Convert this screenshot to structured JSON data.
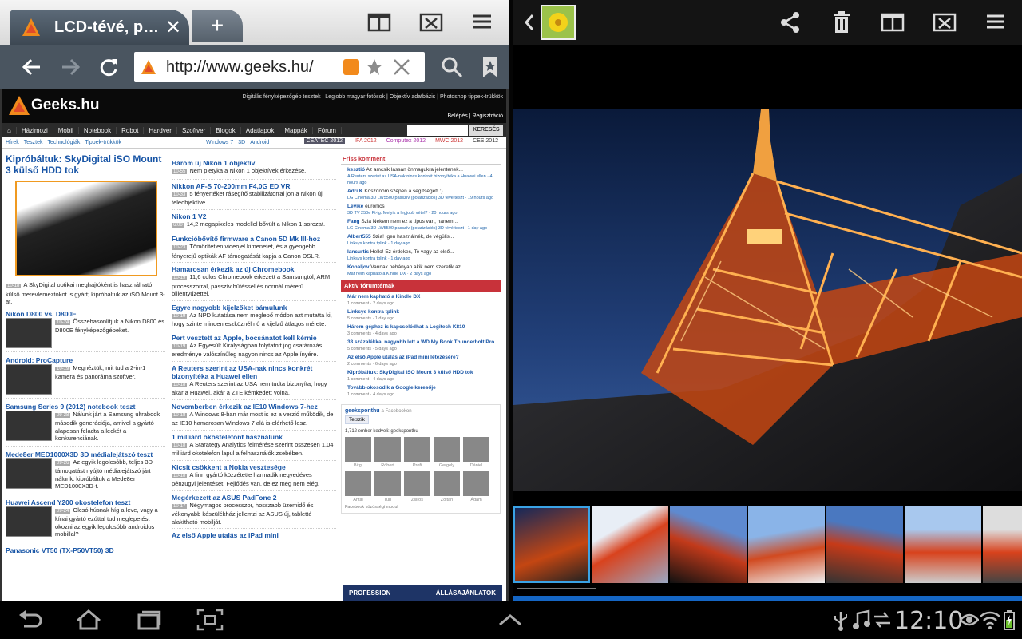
{
  "browser": {
    "tab_title": "LCD-tévé, p…",
    "url": "http://www.geeks.hu/"
  },
  "site": {
    "logo_text": "Geeks.hu",
    "top_links": "Digitális fényképezőgép tesztek | Legjobb magyar fotósok | Objektív adatbázis | Photoshop tippek-trükkök",
    "login": "Belépés | Regisztráció",
    "nav": [
      "Házimozi",
      "Mobil",
      "Notebook",
      "Robot",
      "Hardver",
      "Szoftver",
      "Blogok",
      "Adatlapok",
      "Mappák",
      "Fórum"
    ],
    "search_button": "KERESÉS",
    "sub_nav": [
      "Hírek",
      "Tesztek",
      "Technológiák",
      "Tippek-trükkök"
    ],
    "sub_nav2": [
      "Windows 7",
      "3D",
      "Android"
    ],
    "events": [
      "CEATEC 2012",
      "IFA 2012",
      "Computex 2012",
      "MWC 2012",
      "CES 2012"
    ],
    "main_title": "Kipróbáltuk: SkyDigital iSO Mount 3 külső HDD tok",
    "main_date": "10-18",
    "main_text": "A SkyDigital optikai meghajtóként is használható külső merevlemeztokot is gyárt; kipróbáltuk az iSO Mount 3-at.",
    "left_articles": [
      {
        "title": "Nikon D800 vs. D800E",
        "date": "10-24",
        "text": "Összehasonlítjuk a Nikon D800 és D800E fényképezőgépeket."
      },
      {
        "title": "Android: ProCapture",
        "date": "10-19",
        "text": "Megnéztük, mit tud a 2-in-1 kamera és panoráma szoftver."
      },
      {
        "title": "Samsung Series 9 (2012) notebook teszt",
        "date": "09-28",
        "text": "Nálunk járt a Samsung ultrabook második generációja, amivel a gyártó alaposan feladta a leckét a konkurenciának."
      },
      {
        "title": "Mede8er MED1000X3D 3D médialejátszó teszt",
        "date": "09-26",
        "text": "Az egyik legolcsóbb, teljes 3D támogatást nyújtó médialejátszó járt nálunk: kipróbáltuk a Mede8er MED1000X3D-t."
      },
      {
        "title": "Huawei Ascend Y200 okostelefon teszt",
        "date": "09-24",
        "text": "Olcsó húsnak híg a leve, vagy a kínai gyártó ezúttal tud meglepetést okozni az egyik legolcsóbb androidos mobillal?"
      },
      {
        "title": "Panasonic VT50 (TX-P50VT50) 3D",
        "date": "",
        "text": ""
      }
    ],
    "mid_articles": [
      {
        "title": "Három új Nikon 1 objektív",
        "date": "10-55",
        "text": "Nem pletyka a Nikon 1 objektívek érkezése."
      },
      {
        "title": "Nikkon AF-S 70-200mm F4,0G ED VR",
        "date": "10-33",
        "text": "5 fényértéket rásegítő stabilizátorral jön a Nikon új teleobjektíve."
      },
      {
        "title": "Nikon 1 V2",
        "date": "6:00",
        "text": "14,2 megapixeles modellel bővült a Nikon 1 sorozat."
      },
      {
        "title": "Funkcióbővítő firmware a Canon 5D Mk III-hoz",
        "date": "10-23",
        "text": "Tömörítetlen videojel kimenetet, és a gyengébb fényerejű optikák AF támogatását kapja a Canon DSLR."
      },
      {
        "title": "Hamarosan érkezik az új Chromebook",
        "date": "10-19",
        "text": "11,6 colos Chromebook érkezett a Samsungtól, ARM processzorral, passzív hűtéssel és normál méretű billentyűzettel."
      },
      {
        "title": "Egyre nagyobb kijelzőket bámulunk",
        "date": "10-19",
        "text": "Az NPD kutatása nem meglepő módon azt mutatta ki, hogy szinte minden eszköznél nő a kijelző átlagos mérete."
      },
      {
        "title": "Pert vesztett az Apple, bocsánatot kell kérnie",
        "date": "10-19",
        "text": "Az Egyesült Királyságban folytatott jog csatározás eredménye valószínűleg nagyon nincs az Apple ínyére."
      },
      {
        "title": "A Reuters szerint az USA-nak nincs konkrét bizonyítéka a Huawei ellen",
        "date": "10-18",
        "text": "A Reuters szerint az USA nem tudta bizonyíta, hogy akár a Huawei, akár a ZTE kémkedett volna."
      },
      {
        "title": "Novemberben érkezik az IE10 Windows 7-hez",
        "date": "10-18",
        "text": "A Windows 8-ban már most is ez a verzió működik, de az IE10 hamarosan Windows 7 alá is elérhető lesz."
      },
      {
        "title": "1 milliárd okostelefont használunk",
        "date": "10-18",
        "text": "A Starategy Analytics felmérése szerint összesen 1,04 milliárd okotelefon lapul a felhasználók zsebében."
      },
      {
        "title": "Kicsit csökkent a Nokia vesztesége",
        "date": "10-18",
        "text": "A finn gyártó közzétette harmadik negyedéves pénzügyi jelentését. Fejlődés van, de ez még nem elég."
      },
      {
        "title": "Megérkezett az ASUS PadFone 2",
        "date": "10-17",
        "text": "Négymagos processzor, hosszabb üzemidő és vékonyabb készülékház jellemzi az ASUS új, tabletté alakítható mobilját."
      },
      {
        "title": "Az első Apple utalás az iPad mini",
        "date": "",
        "text": ""
      }
    ],
    "friss_title": "Friss komment",
    "comments": [
      {
        "user": "kesztió",
        "text": "Az amcsik lassan önmagukra jelentenek...",
        "meta": "A Reuters szerint az USA-nak nincs konkrét bizonyítéka a Huawei ellen · 4 hours ago"
      },
      {
        "user": "Adri K",
        "text": "Köszönöm szépen a segítséget! :)",
        "meta": "LG Cinema 3D LW5500 passzív (polarizációs) 3D tévé teszt · 19 hours ago"
      },
      {
        "user": "Levike",
        "text": "euronics",
        "meta": "3D TV 250e Ft-ig. Melyik a legjobb vétel? · 20 hours ago"
      },
      {
        "user": "Fang",
        "text": "Szia Nekem nem ez a típus van, hanem...",
        "meta": "LG Cinema 3D LW5500 passzív (polarizációs) 3D tévé teszt · 1 day ago"
      },
      {
        "user": "Albert555",
        "text": "Szia! Igen használnék, de végülis...",
        "meta": "Linksys kontra tplink · 1 day ago"
      },
      {
        "user": "Iancurtis",
        "text": "Hello! Ez érdekes, Te vagy az első...",
        "meta": "Linksys kontra tplink · 1 day ago"
      },
      {
        "user": "Kobaljov",
        "text": "Vannak néhányan akik nem szeretik az...",
        "meta": "Már nem kapható a Kindle DX · 2 days ago"
      }
    ],
    "forum_title": "Aktív fórumtémák",
    "forum": [
      {
        "title": "Már nem kapható a Kindle DX",
        "meta": "1 comment · 2 days ago"
      },
      {
        "title": "Linksys kontra tplink",
        "meta": "5 comments · 1 day ago"
      },
      {
        "title": "Három géphez is kapcsolódhat a Logitech K810",
        "meta": "3 comments · 4 days ago"
      },
      {
        "title": "33 százalékkal nagyobb lett a WD My Book Thunderbolt Pro",
        "meta": "5 comments · 5 days ago"
      },
      {
        "title": "Az első Apple utalás az iPad mini létezésére?",
        "meta": "2 comments · 6 days ago"
      },
      {
        "title": "Kipróbáltuk: SkyDigital iSO Mount 3 külső HDD tok",
        "meta": "1 comment · 4 days ago"
      },
      {
        "title": "Tovább okosodik a Google keresője",
        "meta": "1 comment · 4 days ago"
      }
    ],
    "fb_page": "geeksponthu",
    "fb_on": "a Facebookon",
    "fb_like": "Tetszik",
    "fb_count": "1,712 ember kedveli: geeksponthu",
    "fb_people": [
      "Birgi",
      "Róbert",
      "Profi",
      "Gergely",
      "Dániel",
      "Antal",
      "Turi",
      "Zsiros",
      "Zoltán",
      "Ádám"
    ],
    "fb_plugin": "Facebook közösségi modul",
    "profession": "PROFESSION",
    "profession_right": "ÁLLÁSAJÁNLATOK"
  },
  "system": {
    "clock": "12:10"
  },
  "colors": {
    "accent": "#1855a6",
    "brand_red": "#c8323a",
    "selection_blue": "#3aa3e6"
  }
}
